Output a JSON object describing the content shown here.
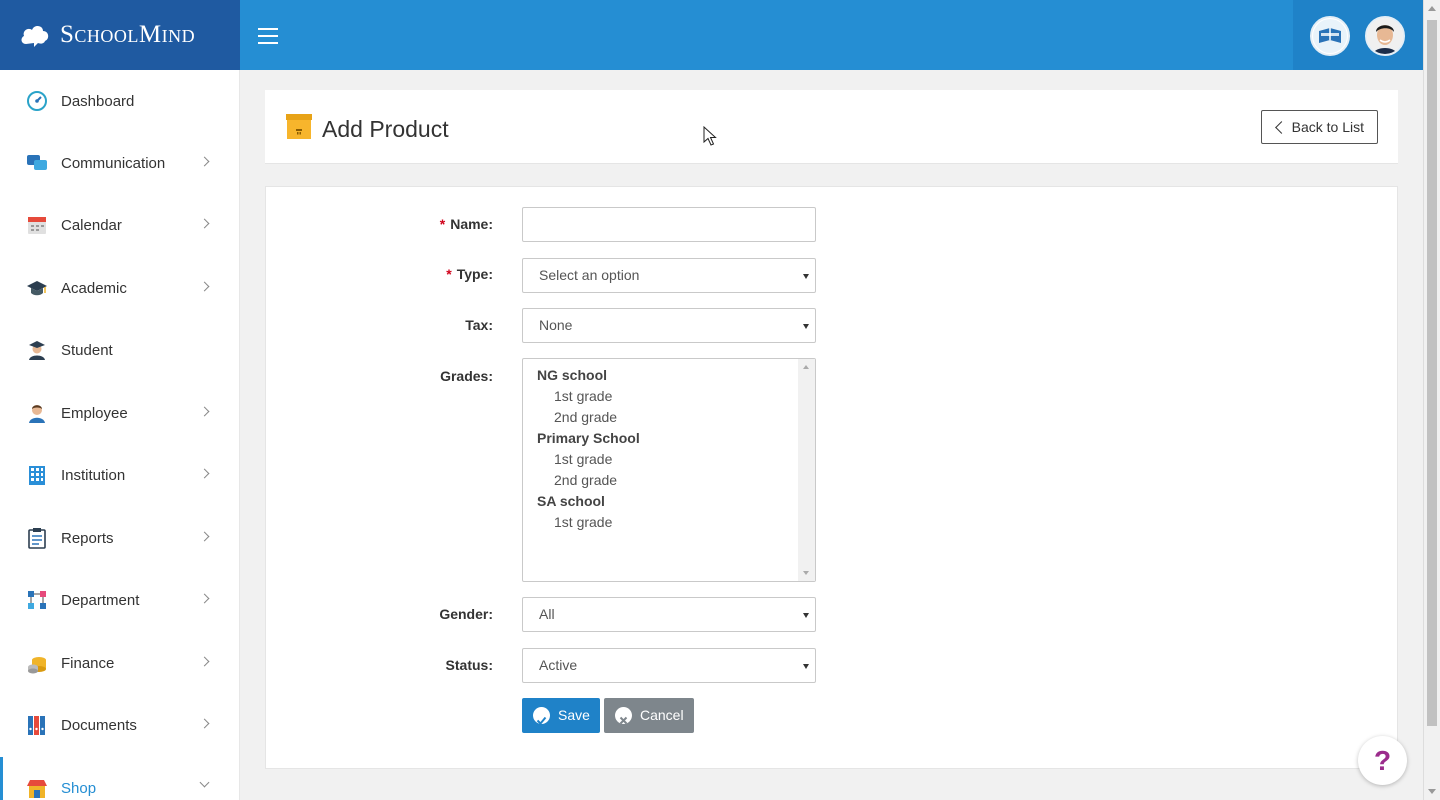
{
  "brand": {
    "name": "SchoolMind"
  },
  "sidebar": {
    "items": [
      {
        "label": "Dashboard",
        "icon": "dashboard-icon",
        "has_chevron": false
      },
      {
        "label": "Communication",
        "icon": "chat-icon",
        "has_chevron": true
      },
      {
        "label": "Calendar",
        "icon": "calendar-icon",
        "has_chevron": true
      },
      {
        "label": "Academic",
        "icon": "graduation-cap-icon",
        "has_chevron": true
      },
      {
        "label": "Student",
        "icon": "student-icon",
        "has_chevron": false
      },
      {
        "label": "Employee",
        "icon": "employee-icon",
        "has_chevron": true
      },
      {
        "label": "Institution",
        "icon": "building-icon",
        "has_chevron": true
      },
      {
        "label": "Reports",
        "icon": "clipboard-icon",
        "has_chevron": true
      },
      {
        "label": "Department",
        "icon": "org-chart-icon",
        "has_chevron": true
      },
      {
        "label": "Finance",
        "icon": "coins-icon",
        "has_chevron": true
      },
      {
        "label": "Documents",
        "icon": "binders-icon",
        "has_chevron": true
      },
      {
        "label": "Shop",
        "icon": "shop-icon",
        "has_chevron": true,
        "active": true
      }
    ]
  },
  "page": {
    "title": "Add Product",
    "back_label": "Back to List"
  },
  "form": {
    "name_label": "Name:",
    "name_value": "",
    "type_label": "Type:",
    "type_value": "Select an option",
    "tax_label": "Tax:",
    "tax_value": "None",
    "grades_label": "Grades:",
    "grades": [
      {
        "group": "NG school",
        "options": [
          "1st grade",
          "2nd grade"
        ]
      },
      {
        "group": "Primary School",
        "options": [
          "1st grade",
          "2nd grade"
        ]
      },
      {
        "group": "SA school",
        "options": [
          "1st grade"
        ]
      }
    ],
    "gender_label": "Gender:",
    "gender_value": "All",
    "status_label": "Status:",
    "status_value": "Active",
    "required_mark": "*",
    "save_label": "Save",
    "cancel_label": "Cancel"
  },
  "help": {
    "label": "?"
  },
  "colors": {
    "header": "#258ed3",
    "brand_bg": "#1f5aa1",
    "primary": "#1f82c8",
    "cancel": "#7e868c",
    "required": "#d0021b",
    "help": "#9b2c8c"
  }
}
